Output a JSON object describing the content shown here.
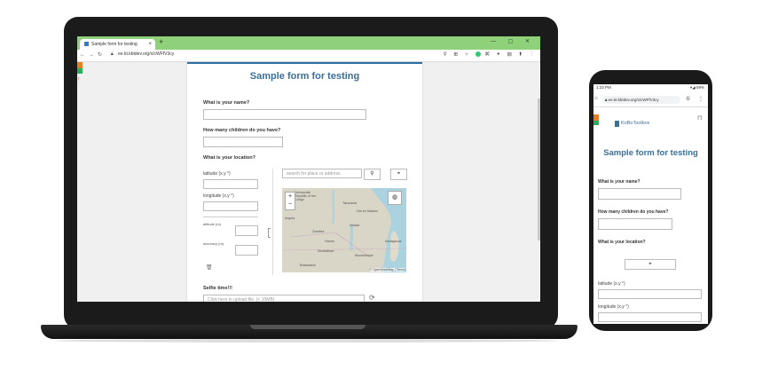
{
  "browser": {
    "tab_title": "Sample form for testing",
    "tab_close": "×",
    "new_tab": "+",
    "url": "ee.kt.kbtdev.org/x/cWFfV3cy",
    "window_controls": "— ▢ ✕"
  },
  "form": {
    "title": "Sample form for testing",
    "q_name": "What is your name?",
    "q_children": "How many children do you have?",
    "q_location": "What is your location?",
    "latitude_label": "latitude (x.y °)",
    "longitude_label": "longitude (x.y °)",
    "altitude_label": "altitude (m)",
    "accuracy_label": "accuracy (m)",
    "search_placeholder": "search for place or address",
    "zoom_in": "+",
    "zoom_out": "−",
    "map_labels": [
      "Democratic Republic of the Congo",
      "Tanzania",
      "Dar es Salaam",
      "Zambia",
      "Malawi",
      "Harare",
      "Zimbabwe",
      "Botswana",
      "Madagascar",
      "Mozambique",
      "Angola"
    ],
    "map_attribution": "© OpenStreetMap | Terms",
    "q_selfie": "Selfie time!!!",
    "upload_placeholder": "Click here to upload file. (< 10MB)"
  },
  "phone": {
    "time": "1:23 PM",
    "signal": "▾◢ 59%",
    "url": "ee.kt.kbtdev.org/x/cWFfV3cy",
    "logo_text": "KoBoToolbox",
    "title": "Sample form for testing",
    "q_name": "What is your name?",
    "q_children": "How many children do you have?",
    "q_location": "What is your location?",
    "latitude_label": "latitude (x.y °)",
    "longitude_label": "longitude (x.y °)"
  },
  "colors": {
    "tab_bar": "#8fd07a",
    "form_title": "#3a6f99",
    "map_water": "#aad3df",
    "map_land": "#d9d5c7"
  }
}
